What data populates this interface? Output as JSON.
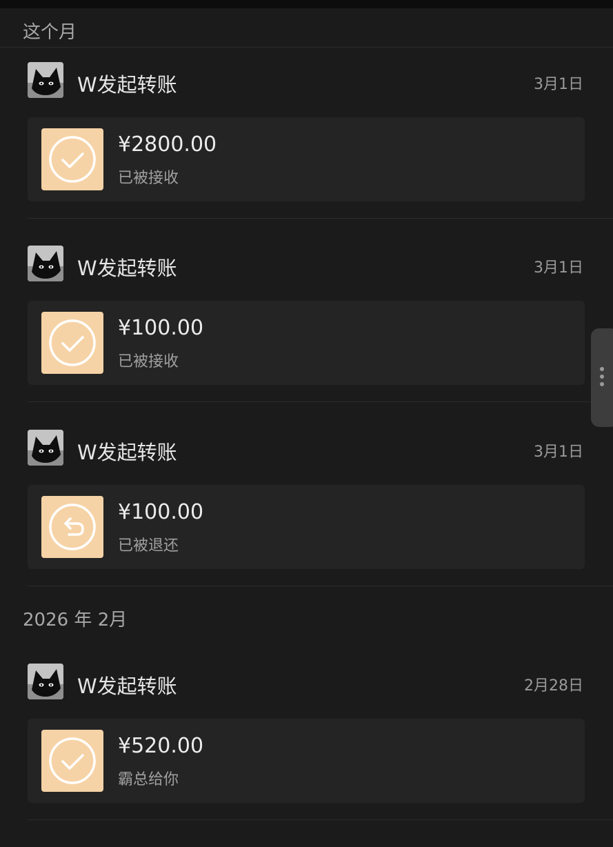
{
  "sections": [
    {
      "title": "这个月"
    },
    {
      "title": "2026 年 2月"
    }
  ],
  "records": [
    {
      "sender": "W发起转账",
      "date": "3月1日",
      "amount": "¥2800.00",
      "status": "已被接收",
      "icon": "check-circle-icon"
    },
    {
      "sender": "W发起转账",
      "date": "3月1日",
      "amount": "¥100.00",
      "status": "已被接收",
      "icon": "check-circle-icon"
    },
    {
      "sender": "W发起转账",
      "date": "3月1日",
      "amount": "¥100.00",
      "status": "已被退还",
      "icon": "return-arrow-icon"
    },
    {
      "sender": "W发起转账",
      "date": "2月28日",
      "amount": "¥520.00",
      "status": "霸总给你",
      "icon": "check-circle-icon"
    }
  ],
  "colors": {
    "background": "#1b1b1b",
    "card": "#242424",
    "icon_bg": "#f6d3a6",
    "muted_text": "#9a9a9a"
  }
}
